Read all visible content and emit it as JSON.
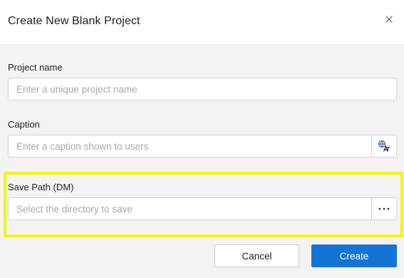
{
  "dialog": {
    "title": "Create New Blank Project",
    "close_icon": "close-icon"
  },
  "fields": {
    "project_name": {
      "label": "Project name",
      "value": "",
      "placeholder": "Enter a unique project name"
    },
    "caption": {
      "label": "Caption",
      "value": "",
      "placeholder": "Enter a caption shown to users",
      "side_icon": "translate-icon"
    },
    "save_path": {
      "label": "Save Path (DM)",
      "value": "",
      "placeholder": "Select the directory to save",
      "side_icon": "more-options-icon"
    }
  },
  "buttons": {
    "cancel_label": "Cancel",
    "create_label": "Create"
  },
  "colors": {
    "accent": "#1473d6",
    "highlight": "#f5f500"
  }
}
